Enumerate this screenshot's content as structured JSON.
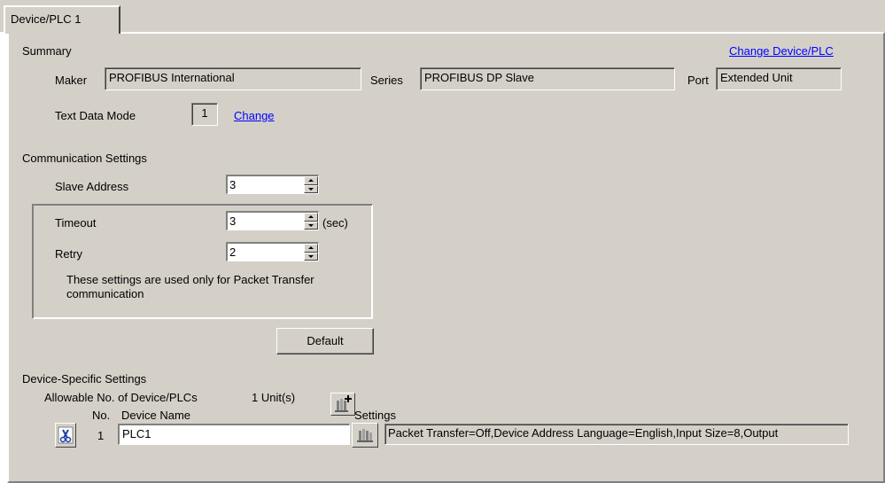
{
  "tab": {
    "label": "Device/PLC 1"
  },
  "summary": {
    "heading": "Summary",
    "change_device_link": "Change Device/PLC",
    "maker_label": "Maker",
    "maker_value": "PROFIBUS International",
    "series_label": "Series",
    "series_value": "PROFIBUS DP Slave",
    "port_label": "Port",
    "port_value": "Extended Unit",
    "text_mode_label": "Text Data Mode",
    "text_mode_value": "1",
    "change_link": "Change"
  },
  "communication": {
    "heading": "Communication Settings",
    "slave_address_label": "Slave Address",
    "slave_address_value": "3",
    "timeout_label": "Timeout",
    "timeout_value": "3",
    "timeout_unit": "(sec)",
    "retry_label": "Retry",
    "retry_value": "2",
    "note": "These settings are used only for Packet Transfer communication",
    "default_button": "Default"
  },
  "device_specific": {
    "heading": "Device-Specific Settings",
    "allowable_label": "Allowable No. of Device/PLCs",
    "allowable_value": "1 Unit(s)",
    "col_no": "No.",
    "col_device_name": "Device Name",
    "col_settings": "Settings",
    "rows": [
      {
        "no": "1",
        "device_name": "PLC1",
        "settings": "Packet Transfer=Off,Device Address Language=English,Input Size=8,Output"
      }
    ]
  },
  "icons": {
    "add_device": "add-device-icon",
    "delete_device": "scissors-icon",
    "device_settings": "settings-icon"
  },
  "colors": {
    "face": "#d4d0c8",
    "link": "#0000ff",
    "icon_blue": "#1a3fa8"
  }
}
